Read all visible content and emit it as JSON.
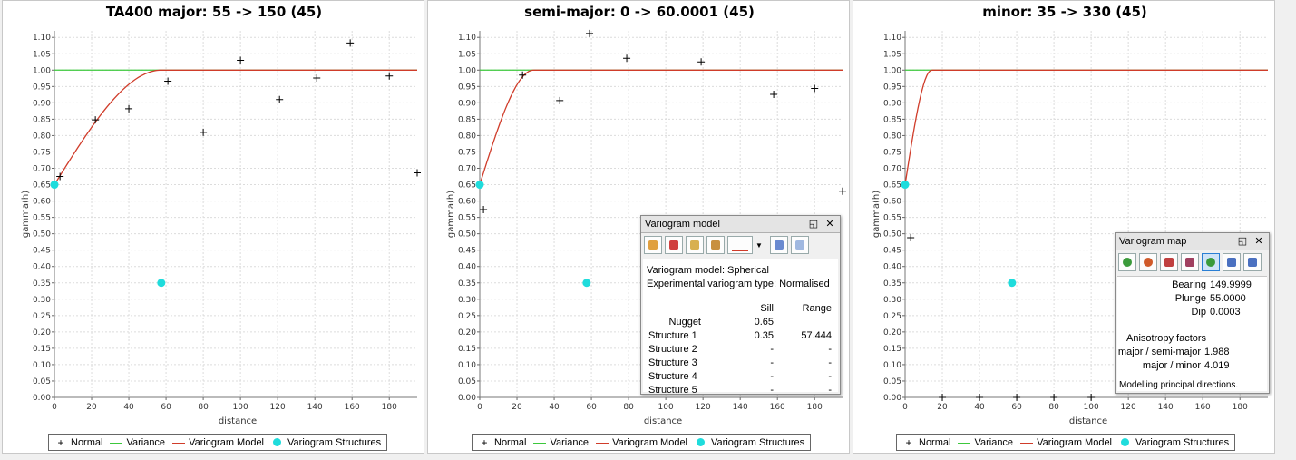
{
  "legend": [
    "Normal",
    "Variance",
    "Variogram Model",
    "Variogram Structures"
  ],
  "colors": {
    "variance": "#3cc83c",
    "model": "#d03c2a",
    "structures": "#1fdcdc",
    "normal": "#000000"
  },
  "chart_data": [
    {
      "type": "scatter",
      "title": "TA400 major: 55 -> 150 (45)",
      "xlabel": "distance",
      "ylabel": "gamma(h)",
      "xlim": [
        0,
        195
      ],
      "ylim": [
        0,
        1.12
      ],
      "xticks": [
        0,
        20,
        40,
        60,
        80,
        100,
        120,
        140,
        160,
        180
      ],
      "yticks": [
        0,
        0.05,
        0.1,
        0.15,
        0.2,
        0.25,
        0.3,
        0.35,
        0.4,
        0.45,
        0.5,
        0.55,
        0.6,
        0.65,
        0.7,
        0.75,
        0.8,
        0.85,
        0.9,
        0.95,
        1.0,
        1.05,
        1.1
      ],
      "grid": true,
      "series": [
        {
          "name": "Normal",
          "x": [
            3,
            22,
            40,
            61,
            80,
            100,
            121,
            141,
            159,
            180,
            195
          ],
          "y": [
            0.675,
            0.848,
            0.882,
            0.966,
            0.81,
            1.03,
            0.91,
            0.976,
            1.083,
            0.982,
            0.686
          ]
        },
        {
          "name": "Variance",
          "y": 1.0
        },
        {
          "name": "Variogram Model",
          "model": "spherical",
          "nugget": 0.65,
          "sill": 0.35,
          "range": 57.444
        },
        {
          "name": "Variogram Structures",
          "x": [
            0,
            57.444
          ],
          "y": [
            0.65,
            0.35
          ]
        }
      ]
    },
    {
      "type": "scatter",
      "title": "semi-major: 0 -> 60.0001 (45)",
      "xlabel": "distance",
      "ylabel": "gamma(h)",
      "xlim": [
        0,
        195
      ],
      "ylim": [
        0,
        1.12
      ],
      "xticks": [
        0,
        20,
        40,
        60,
        80,
        100,
        120,
        140,
        160,
        180
      ],
      "yticks": [
        0,
        0.05,
        0.1,
        0.15,
        0.2,
        0.25,
        0.3,
        0.35,
        0.4,
        0.45,
        0.5,
        0.55,
        0.6,
        0.65,
        0.7,
        0.75,
        0.8,
        0.85,
        0.9,
        0.95,
        1.0,
        1.05,
        1.1
      ],
      "grid": true,
      "series": [
        {
          "name": "Normal",
          "x": [
            2,
            23,
            43,
            59,
            79,
            119,
            158,
            180,
            195
          ],
          "y": [
            0.574,
            0.985,
            0.907,
            1.112,
            1.036,
            1.025,
            0.926,
            0.944,
            0.63
          ]
        },
        {
          "name": "Variance",
          "y": 1.0
        },
        {
          "name": "Variogram Model",
          "model": "spherical",
          "nugget": 0.65,
          "sill": 0.35,
          "range": 28.9
        },
        {
          "name": "Variogram Structures",
          "x": [
            0,
            57.444
          ],
          "y": [
            0.65,
            0.35
          ]
        }
      ]
    },
    {
      "type": "scatter",
      "title": "minor: 35 -> 330 (45)",
      "xlabel": "distance",
      "ylabel": "gamma(h)",
      "xlim": [
        0,
        195
      ],
      "ylim": [
        0,
        1.12
      ],
      "xticks": [
        0,
        20,
        40,
        60,
        80,
        100,
        120,
        140,
        160,
        180
      ],
      "yticks": [
        0,
        0.05,
        0.1,
        0.15,
        0.2,
        0.25,
        0.3,
        0.35,
        0.4,
        0.45,
        0.5,
        0.55,
        0.6,
        0.65,
        0.7,
        0.75,
        0.8,
        0.85,
        0.9,
        0.95,
        1.0,
        1.05,
        1.1
      ],
      "grid": true,
      "series": [
        {
          "name": "Normal",
          "x": [
            3,
            20,
            40,
            60,
            80,
            100
          ],
          "y": [
            0.488,
            0.0,
            0.0,
            0.0,
            0.0,
            0.0
          ]
        },
        {
          "name": "Variance",
          "y": 1.0
        },
        {
          "name": "Variogram Model",
          "model": "spherical",
          "nugget": 0.65,
          "sill": 0.35,
          "range": 14.3
        },
        {
          "name": "Variogram Structures",
          "x": [
            0,
            57.444
          ],
          "y": [
            0.65,
            0.35
          ]
        }
      ]
    }
  ],
  "variogram_model_window": {
    "title": "Variogram model",
    "model_line": "Variogram model: Spherical",
    "type_line": "Experimental variogram type: Normalised",
    "headers": [
      "",
      "Sill",
      "Range"
    ],
    "rows": [
      [
        "Nugget",
        "0.65",
        ""
      ],
      [
        "Structure 1",
        "0.35",
        "57.444"
      ],
      [
        "Structure 2",
        "-",
        "-"
      ],
      [
        "Structure 3",
        "-",
        "-"
      ],
      [
        "Structure 4",
        "-",
        "-"
      ],
      [
        "Structure 5",
        "-",
        "-"
      ]
    ]
  },
  "variogram_map_window": {
    "title": "Variogram map",
    "bearing_label": "Bearing",
    "bearing": "149.9999",
    "plunge_label": "Plunge",
    "plunge": "55.0000",
    "dip_label": "Dip",
    "dip": "0.0003",
    "anis_label": "Anisotropy factors",
    "semi_label": "major / semi-major",
    "semi": "1.988",
    "minor_label": "major / minor",
    "minor": "4.019",
    "status": "Modelling principal directions."
  }
}
